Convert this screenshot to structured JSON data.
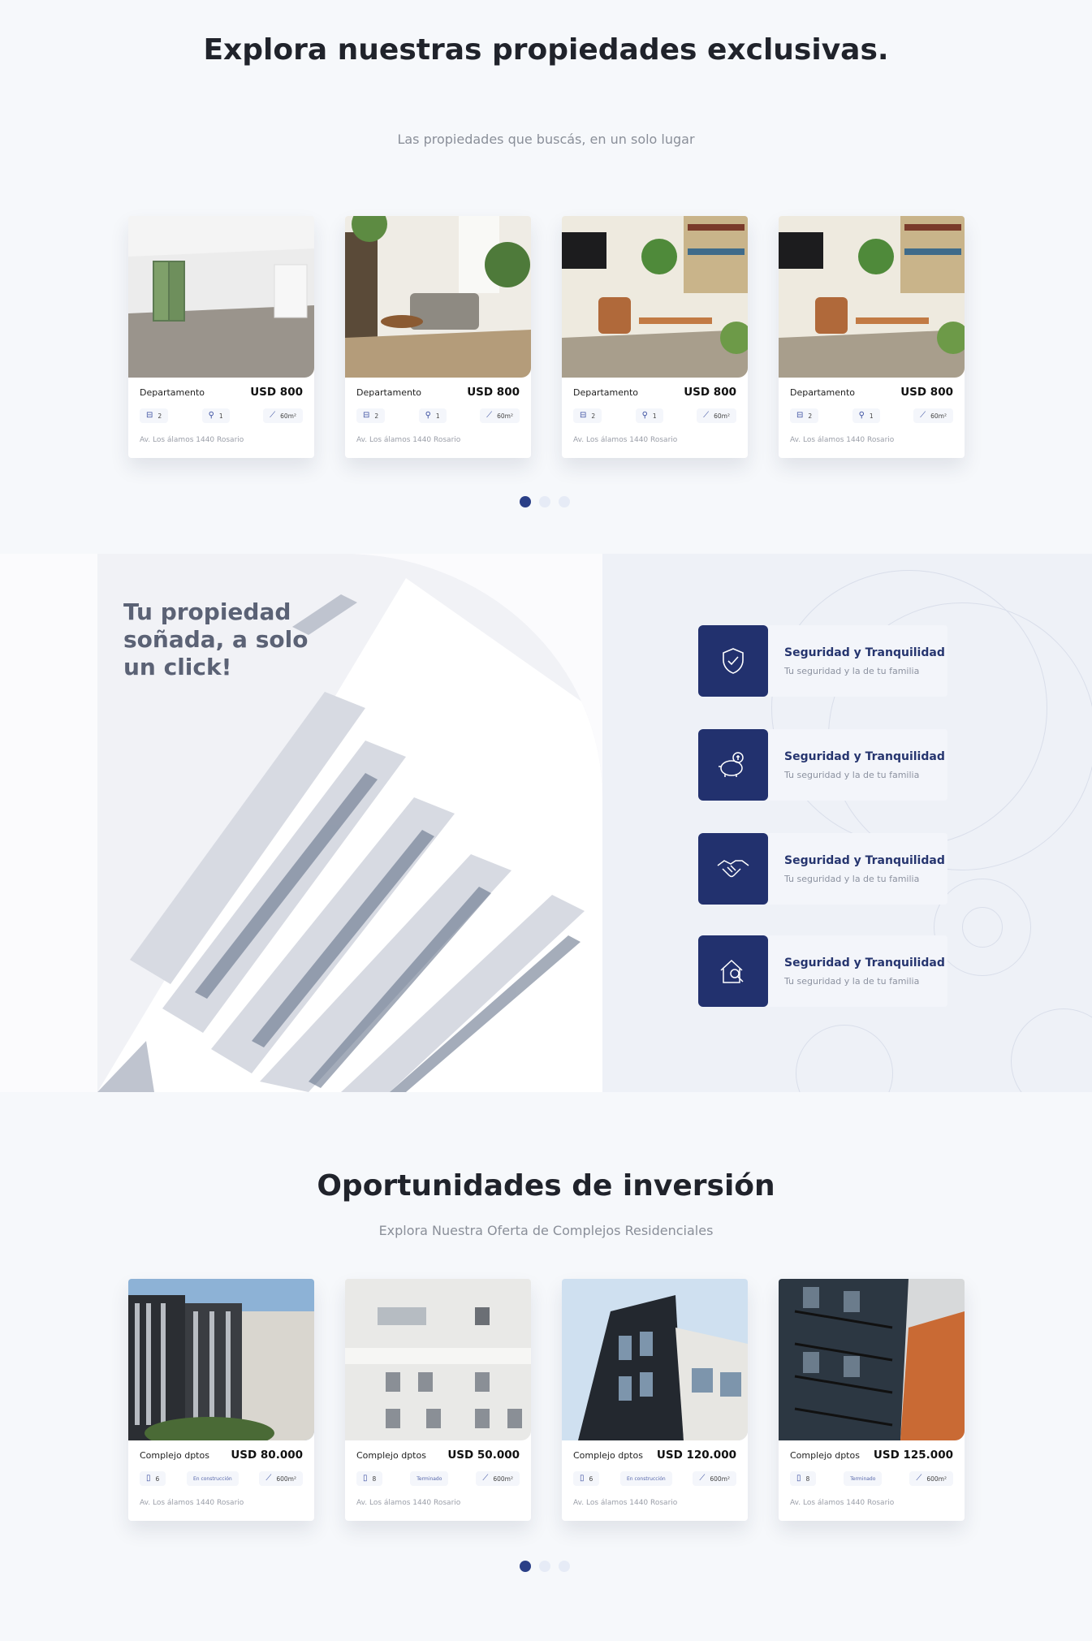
{
  "hero": {
    "title": "Explora nuestras propiedades exclusivas.",
    "subtitle": "Las propiedades que buscás, en un solo lugar"
  },
  "properties": [
    {
      "type": "Departamento",
      "price": "USD 800",
      "beds": "2",
      "baths": "1",
      "area": "60m²",
      "address": "Av. Los álamos 1440 Rosario",
      "image": "empty-apartment-room"
    },
    {
      "type": "Departamento",
      "price": "USD 800",
      "beds": "2",
      "baths": "1",
      "area": "60m²",
      "address": "Av. Los álamos 1440 Rosario",
      "image": "living-room-sofa"
    },
    {
      "type": "Departamento",
      "price": "USD 800",
      "beds": "2",
      "baths": "1",
      "area": "60m²",
      "address": "Av. Los álamos 1440 Rosario",
      "image": "dining-room-plants"
    },
    {
      "type": "Departamento",
      "price": "USD 800",
      "beds": "2",
      "baths": "1",
      "area": "60m²",
      "address": "Av. Los álamos 1440 Rosario",
      "image": "dining-room-plants"
    }
  ],
  "carousel_top": {
    "pages": 3,
    "active": 1
  },
  "band": {
    "title": "Tu propiedad soñada, a solo un click!",
    "benefits": [
      {
        "icon": "shield-check-icon",
        "title": "Seguridad y Tranquilidad",
        "desc": "Tu seguridad y la de tu familia"
      },
      {
        "icon": "piggy-bank-icon",
        "title": "Seguridad y Tranquilidad",
        "desc": "Tu seguridad y la de tu familia"
      },
      {
        "icon": "handshake-icon",
        "title": "Seguridad y Tranquilidad",
        "desc": "Tu seguridad y la de tu familia"
      },
      {
        "icon": "house-search-icon",
        "title": "Seguridad y Tranquilidad",
        "desc": "Tu seguridad y la de tu familia"
      }
    ]
  },
  "investments": {
    "title": "Oportunidades de inversión",
    "subtitle": "Explora Nuestra Oferta de Complejos Residenciales",
    "items": [
      {
        "type": "Complejo dptos",
        "price": "USD 80.000",
        "floors": "6",
        "status": "En construcción",
        "area": "600m²",
        "address": "Av. Los álamos 1440 Rosario",
        "image": "tower-blocks"
      },
      {
        "type": "Complejo dptos",
        "price": "USD 50.000",
        "floors": "8",
        "status": "Terminado",
        "area": "600m²",
        "address": "Av. Los álamos 1440 Rosario",
        "image": "white-facade"
      },
      {
        "type": "Complejo dptos",
        "price": "USD 120.000",
        "floors": "6",
        "status": "En construcción",
        "area": "600m²",
        "address": "Av. Los álamos 1440 Rosario",
        "image": "modern-dark-building"
      },
      {
        "type": "Complejo dptos",
        "price": "USD 125.000",
        "floors": "8",
        "status": "Terminado",
        "area": "600m²",
        "address": "Av. Los álamos 1440 Rosario",
        "image": "balcony-building"
      }
    ]
  },
  "carousel_bottom": {
    "pages": 3,
    "active": 1
  }
}
